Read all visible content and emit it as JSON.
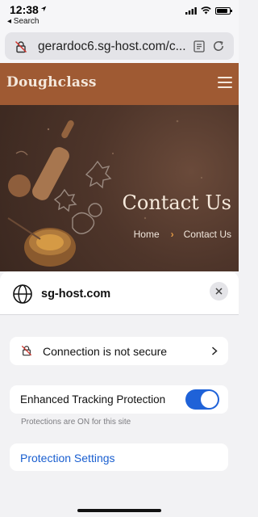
{
  "status_bar": {
    "time": "12:38",
    "back_label": "◂ Search",
    "icons": [
      "location-arrow-icon",
      "cellular-signal-icon",
      "wifi-icon",
      "battery-icon"
    ]
  },
  "address_bar": {
    "url": "gerardoc6.sg-host.com/c...",
    "icons": [
      "not-secure-lock-icon",
      "reader-view-icon",
      "reload-icon"
    ]
  },
  "site": {
    "brand": "Doughclass",
    "header_color": "#9f5a33",
    "hero": {
      "title": "Contact Us",
      "breadcrumb": {
        "home": "Home",
        "separator": "›",
        "current": "Contact Us"
      }
    }
  },
  "site_info_sheet": {
    "domain": "sg-host.com",
    "connection_label": "Connection is not secure",
    "etp_label": "Enhanced Tracking Protection",
    "etp_enabled": true,
    "etp_status": "Protections are ON for this site",
    "protection_settings_label": "Protection Settings",
    "accent_color": "#1f62d8",
    "link_color": "#1a5fd0"
  }
}
